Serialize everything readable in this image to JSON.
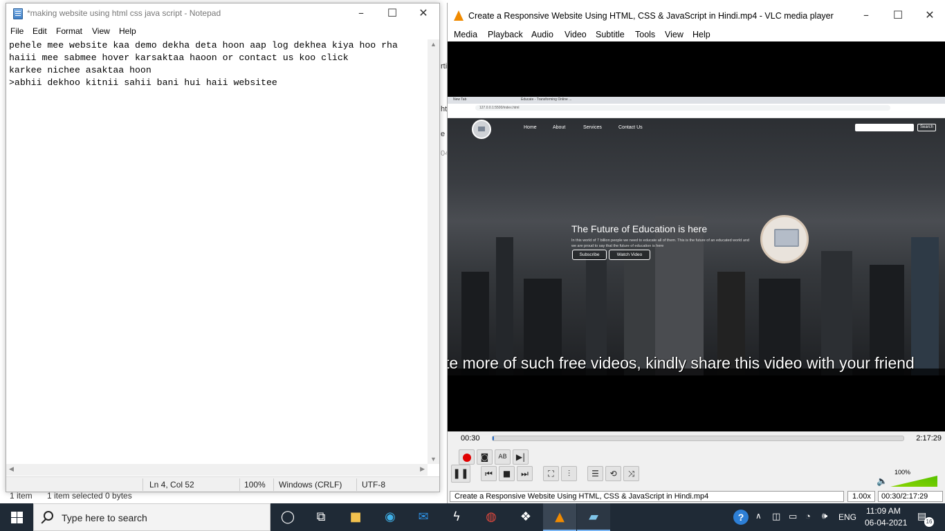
{
  "explorer": {
    "status_items": "1 item",
    "status_selected": "1 item selected  0 bytes",
    "peek_1": "rti",
    "peek_2": "ht",
    "peek_3": "e",
    "peek_4": "04"
  },
  "notepad": {
    "title": "*making website using html css java script - Notepad",
    "menu": [
      "File",
      "Edit",
      "Format",
      "View",
      "Help"
    ],
    "text": "pehele mee website kaa demo dekha deta hoon aap log dekhea kiya hoo rha\nhaiii mee sabmee hover karsaktaa haoon or contact us koo click\nkarkee nichee asaktaa hoon\n>abhii dekhoo kitnii sahii bani hui haii websitee",
    "status": {
      "position": "Ln 4, Col 52",
      "zoom": "100%",
      "line_ending": "Windows (CRLF)",
      "encoding": "UTF-8"
    }
  },
  "vlc": {
    "title": "Create a Responsive Website Using HTML, CSS & JavaScript in Hindi.mp4 - VLC media player",
    "menu": [
      "Media",
      "Playback",
      "Audio",
      "Video",
      "Subtitle",
      "Tools",
      "View",
      "Help"
    ],
    "time_current": "00:30",
    "time_total": "2:17:29",
    "progress": 0.004,
    "volume": "100%",
    "status_file": "Create a Responsive Website Using HTML, CSS & JavaScript in Hindi.mp4",
    "status_speed": "1.00x",
    "status_time": "00:30/2:17:29",
    "subtitle": "te more of such free videos, kindly share this video with your friend",
    "video_site": {
      "tab1": "New Tab",
      "tab2": "Educate - Transforming Online ...",
      "url": "127.0.0.1:5500/index.html",
      "nav": [
        "Home",
        "About",
        "Services",
        "Contact Us"
      ],
      "search_btn": "Search",
      "hero_title": "The Future of Education is here",
      "hero_sub": "In this world of 7 billion people we need to educate all of them. This is the future of an educated world and we are proud to say that the future of education is here",
      "btn_subscribe": "Subscribe",
      "btn_watch": "Watch Video"
    }
  },
  "taskbar": {
    "search_placeholder": "Type here to search",
    "language": "ENG",
    "time": "11:09 AM",
    "date": "06-04-2021",
    "notification_count": "16"
  }
}
